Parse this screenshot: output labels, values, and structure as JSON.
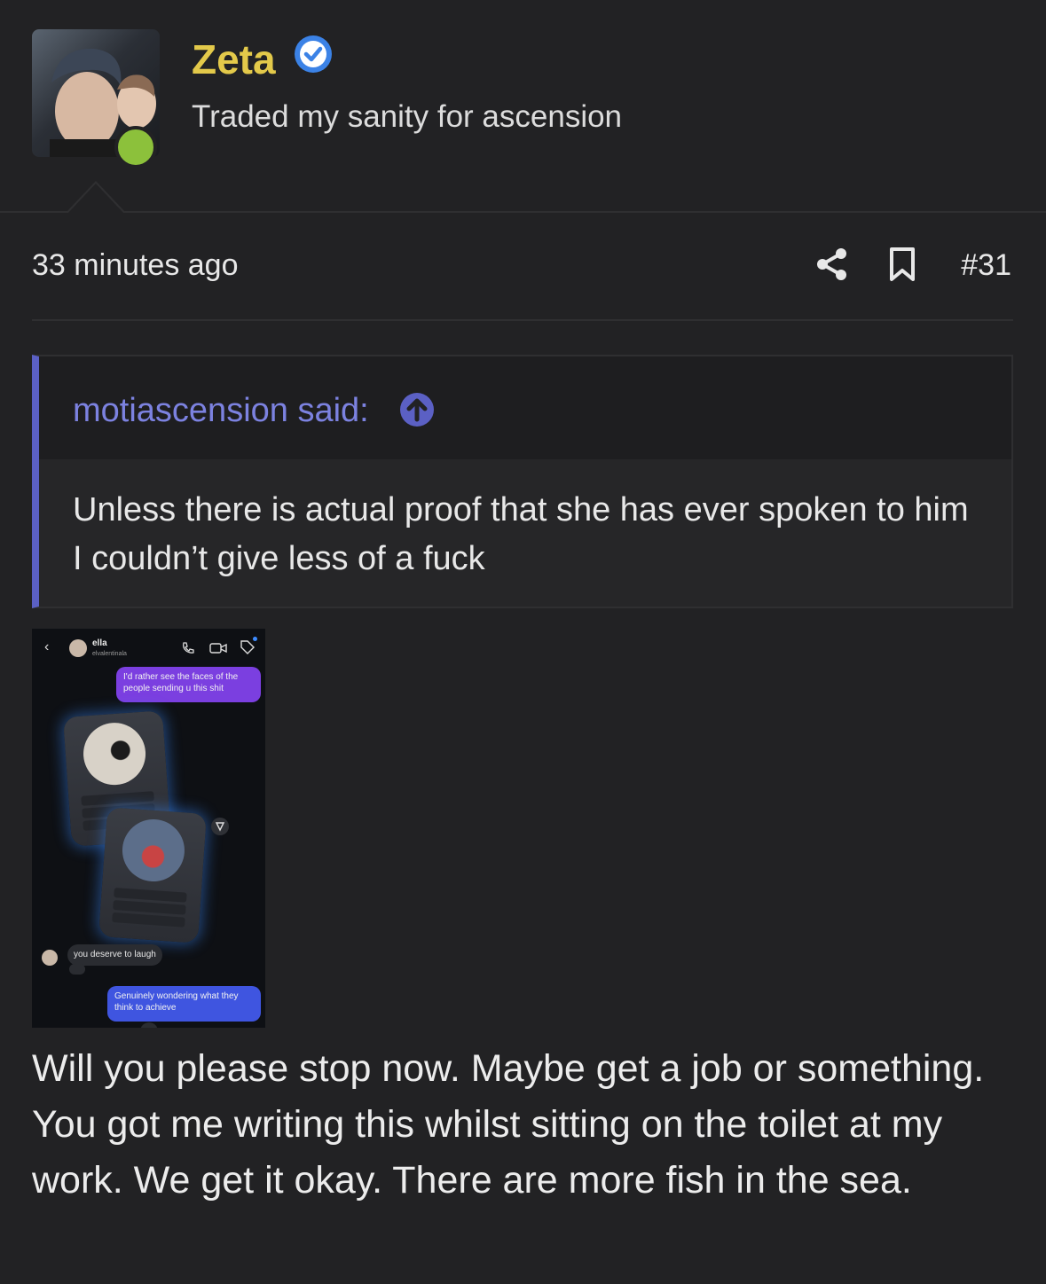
{
  "author": {
    "name": "Zeta",
    "title": "Traded my sanity for ascension",
    "verified_icon": "verified-check-icon",
    "online": true,
    "name_color": "#e3c94a"
  },
  "meta": {
    "timestamp": "33 minutes ago",
    "post_number": "#31",
    "share_icon": "share-icon",
    "bookmark_icon": "bookmark-icon"
  },
  "quote": {
    "author_line": "motiascension said:",
    "jump_icon": "arrow-up-circle-icon",
    "text": "Unless there is actual proof that she has ever spoken to him I couldn’t give less of a fuck",
    "accent_color": "#5b60c4"
  },
  "attachment": {
    "contact_name": "ella",
    "contact_handle": "elvalentinala",
    "messages": [
      "I'd rather see the faces of the people sending u this shit",
      "you deserve to laugh",
      "Genuinely wondering what they think to achieve"
    ]
  },
  "body": {
    "text": "Will you please stop now. Maybe get a job or something. You got me writing this whilst sitting on the toilet at my work. We get it okay. There are more fish in the sea."
  }
}
